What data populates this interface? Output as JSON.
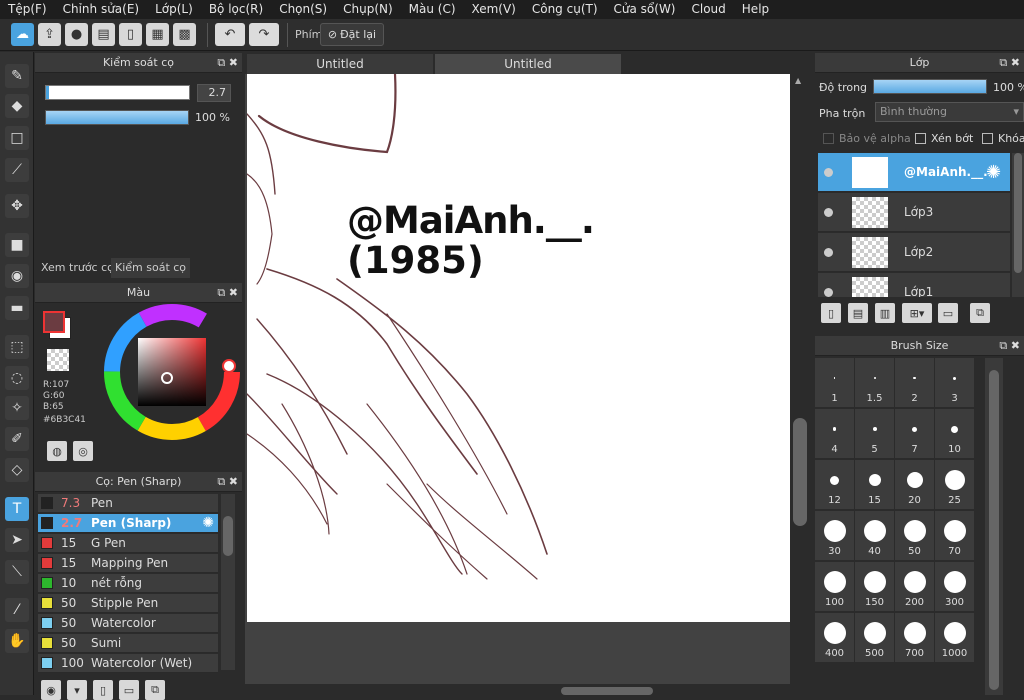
{
  "menu": [
    "Tệp(F)",
    "Chỉnh sửa(E)",
    "Lớp(L)",
    "Bộ lọc(R)",
    "Chọn(S)",
    "Chụp(N)",
    "Màu (C)",
    "Xem(V)",
    "Công cụ(T)",
    "Cửa sổ(W)",
    "Cloud",
    "Help"
  ],
  "toolbar": {
    "key_label": "Phím",
    "reset_label": "Đặt lại"
  },
  "brush_control": {
    "title": "Kiểm soát cọ",
    "size_value": "2.7",
    "opacity_value": "100 %",
    "tab_preview": "Xem trước cọ",
    "tab_control": "Kiểm soát cọ"
  },
  "color_panel": {
    "title": "Màu",
    "r": "R:107",
    "g": "G:60",
    "b": "B:65",
    "hex": "#6B3C41",
    "foreground": "#6b3c41"
  },
  "brush_list": {
    "title": "Cọ: Pen (Sharp)",
    "items": [
      {
        "size": "7.3",
        "name": "Pen",
        "swatch": "#222222",
        "red": true
      },
      {
        "size": "2.7",
        "name": "Pen (Sharp)",
        "swatch": "#222222",
        "red": true,
        "selected": true
      },
      {
        "size": "15",
        "name": "G Pen",
        "swatch": "#e33b3b"
      },
      {
        "size": "15",
        "name": "Mapping Pen",
        "swatch": "#e33b3b"
      },
      {
        "size": "10",
        "name": "nét rỗng",
        "swatch": "#2db82d"
      },
      {
        "size": "50",
        "name": "Stipple Pen",
        "swatch": "#e8e03a"
      },
      {
        "size": "50",
        "name": "Watercolor",
        "swatch": "#7dcff0"
      },
      {
        "size": "50",
        "name": "Sumi",
        "swatch": "#e8e03a"
      },
      {
        "size": "100",
        "name": "Watercolor (Wet)",
        "swatch": "#7dcff0"
      }
    ]
  },
  "documents": {
    "tabs": [
      "Untitled",
      "Untitled"
    ]
  },
  "canvas": {
    "line1": "@MaiAnh.__.",
    "line2": "(1985)",
    "stroke_color": "#6b3c41"
  },
  "layers": {
    "title": "Lớp",
    "opacity_label": "Độ trong",
    "opacity_value": "100 %",
    "blend_label": "Pha trộn",
    "blend_value": "Bình thường",
    "protect_alpha": "Bảo vệ alpha",
    "clipping": "Xén bớt",
    "lock": "Khóa",
    "items": [
      "@MaiAnh.__.",
      "Lớp3",
      "Lớp2",
      "Lớp1"
    ]
  },
  "brush_size": {
    "title": "Brush Size",
    "sizes": [
      "1",
      "1.5",
      "2",
      "3",
      "4",
      "5",
      "7",
      "10",
      "12",
      "15",
      "20",
      "25",
      "30",
      "40",
      "50",
      "70",
      "100",
      "150",
      "200",
      "300",
      "400",
      "500",
      "700",
      "1000"
    ]
  },
  "colors": {
    "accent": "#4aa3df",
    "canvas_bg": "#ffffff",
    "panel_bg": "#2b2b2b"
  }
}
